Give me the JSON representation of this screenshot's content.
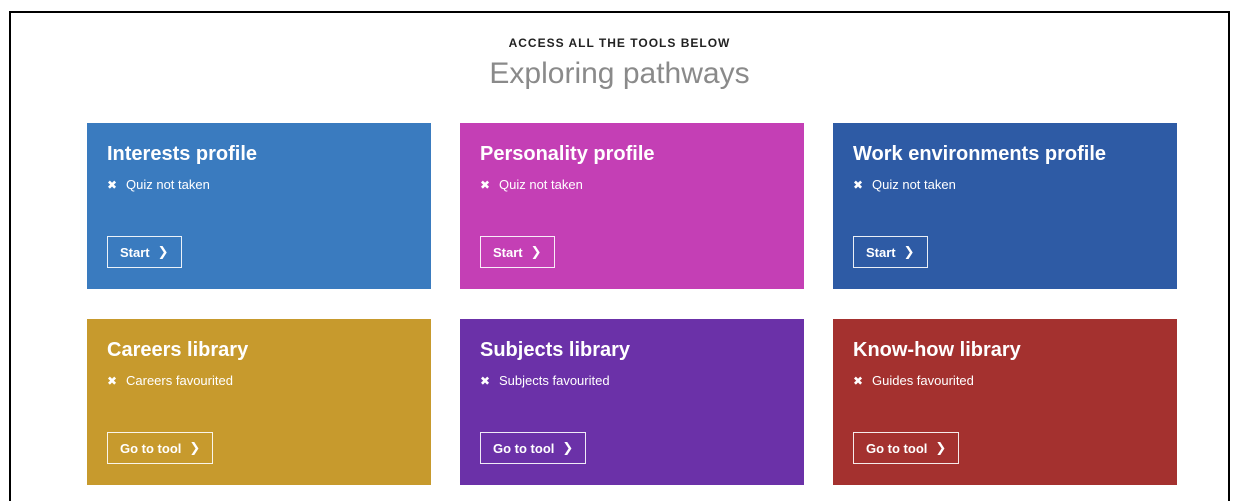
{
  "header": {
    "eyebrow": "ACCESS ALL THE TOOLS BELOW",
    "title": "Exploring pathways"
  },
  "cards": [
    {
      "title": "Interests profile",
      "status": "Quiz not taken",
      "button": "Start",
      "color": "#3a7bbf"
    },
    {
      "title": "Personality profile",
      "status": "Quiz not taken",
      "button": "Start",
      "color": "#c43fb5"
    },
    {
      "title": "Work environments profile",
      "status": "Quiz not taken",
      "button": "Start",
      "color": "#2e5ba5"
    },
    {
      "title": "Careers library",
      "status": "Careers favourited",
      "button": "Go to tool",
      "color": "#c79a2d"
    },
    {
      "title": "Subjects library",
      "status": "Subjects favourited",
      "button": "Go to tool",
      "color": "#6b31a8"
    },
    {
      "title": "Know-how library",
      "status": "Guides favourited",
      "button": "Go to tool",
      "color": "#a4312f"
    }
  ],
  "icons": {
    "status": "close-icon",
    "button": "chevron-right-icon"
  }
}
